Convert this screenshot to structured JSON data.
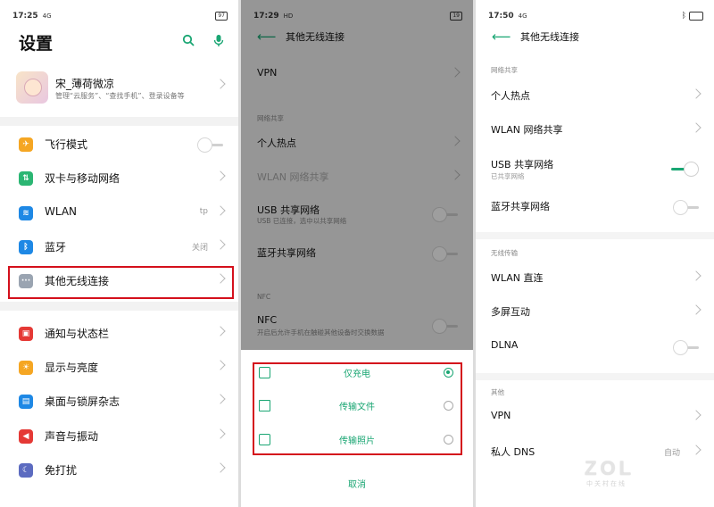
{
  "panel1": {
    "status": {
      "time": "17:25",
      "signal": "4G",
      "battery": "97"
    },
    "title": "设置",
    "icons": [
      "search-icon",
      "mic-icon"
    ],
    "profile": {
      "name": "宋_薄荷微凉",
      "subtitle": "管理“云服务”、“查找手机”、登录设备等"
    },
    "items": [
      {
        "label": "飞行模式",
        "icon": "airplane-icon",
        "color": "#f5a623",
        "toggle": "off"
      },
      {
        "label": "双卡与移动网络",
        "icon": "sim-icon",
        "color": "#2bb673"
      },
      {
        "label": "WLAN",
        "icon": "wifi-icon",
        "color": "#1e88e5",
        "value": "tp"
      },
      {
        "label": "蓝牙",
        "icon": "bluetooth-icon",
        "color": "#1e88e5",
        "value": "关闭"
      },
      {
        "label": "其他无线连接",
        "icon": "more-icon",
        "color": "#9aa4b1"
      },
      {
        "label": "通知与状态栏",
        "icon": "notification-icon",
        "color": "#e53935"
      },
      {
        "label": "显示与亮度",
        "icon": "brightness-icon",
        "color": "#f5a623"
      },
      {
        "label": "桌面与锁屏杂志",
        "icon": "wallpaper-icon",
        "color": "#1e88e5"
      },
      {
        "label": "声音与振动",
        "icon": "sound-icon",
        "color": "#e53935"
      },
      {
        "label": "免打扰",
        "icon": "moon-icon",
        "color": "#5c6bc0"
      }
    ]
  },
  "panel2": {
    "status": {
      "time": "17:29",
      "signal": "HD",
      "battery": "19"
    },
    "title": "其他无线连接",
    "vpn": "VPN",
    "section_share": "网络共享",
    "hotspot": "个人热点",
    "wlan_share": "WLAN 网络共享",
    "usb_share": "USB 共享网络",
    "usb_share_sub": "USB 已连接，选中以共享网络",
    "bt_share": "蓝牙共享网络",
    "section_nfc": "NFC",
    "nfc": "NFC",
    "nfc_sub": "开启后允许手机在触碰其他设备时交换数据",
    "sheet": {
      "options": [
        {
          "label": "仅充电",
          "icon": "charge-icon",
          "selected": true
        },
        {
          "label": "传输文件",
          "icon": "folder-icon",
          "selected": false
        },
        {
          "label": "传输照片",
          "icon": "photo-icon",
          "selected": false
        }
      ],
      "cancel": "取消"
    }
  },
  "panel3": {
    "status": {
      "time": "17:50",
      "signal": "4G",
      "battery": ""
    },
    "title": "其他无线连接",
    "section_share": "网络共享",
    "hotspot": "个人热点",
    "wlan_share": "WLAN 网络共享",
    "usb_share": "USB 共享网络",
    "usb_share_sub": "已共享网络",
    "bt_share": "蓝牙共享网络",
    "section_wireless": "无线传输",
    "wlan_direct": "WLAN 直连",
    "multiscreen": "多屏互动",
    "dlna": "DLNA",
    "section_other": "其他",
    "vpn": "VPN",
    "private_dns": "私人 DNS",
    "private_dns_value": "自动"
  },
  "watermark": {
    "text": "ZOL",
    "sub": "中关村在线"
  }
}
